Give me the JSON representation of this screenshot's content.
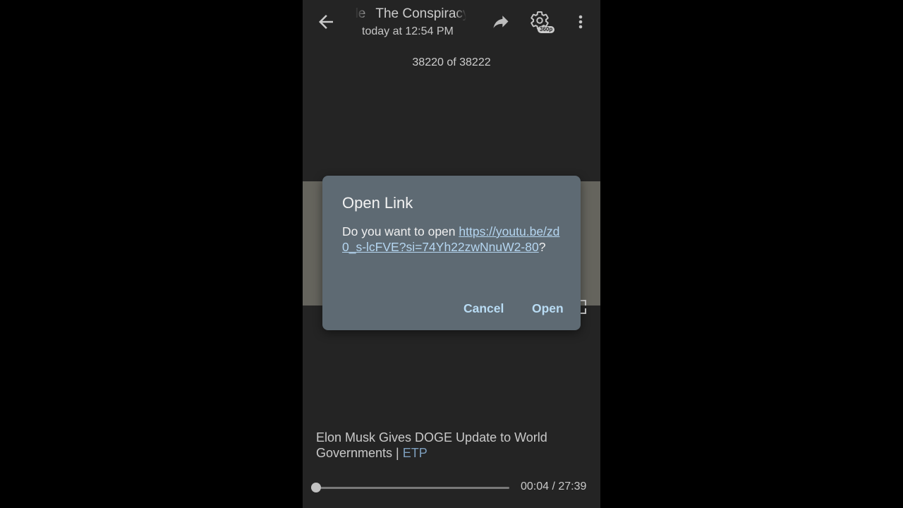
{
  "header": {
    "title_lead": "ple",
    "title_main": "The Conspiracy",
    "subtitle": "today at 12:54 PM",
    "quality": "360p"
  },
  "counter": "38220 of 38222",
  "icons": [
    "back-arrow-icon",
    "share-icon",
    "gear-icon",
    "more-vert-icon",
    "fullscreen-icon"
  ],
  "dialog": {
    "title": "Open Link",
    "prefix": "Do you want to open ",
    "url": "https://youtu.be/zd0_s-lcFVE?si=74Yh22zwNnuW2-80",
    "suffix": "?",
    "cancel_label": "Cancel",
    "open_label": "Open"
  },
  "caption": {
    "text": "Elon Musk Gives DOGE Update to World Governments | ",
    "link": "ETP"
  },
  "player": {
    "time": "00:04 / 27:39",
    "progress": 0.0024
  },
  "colors": {
    "background": "#2a2a2a",
    "dialog": "#5e6a73",
    "accent": "#b9dcf4",
    "link": "#8fb4d8"
  }
}
